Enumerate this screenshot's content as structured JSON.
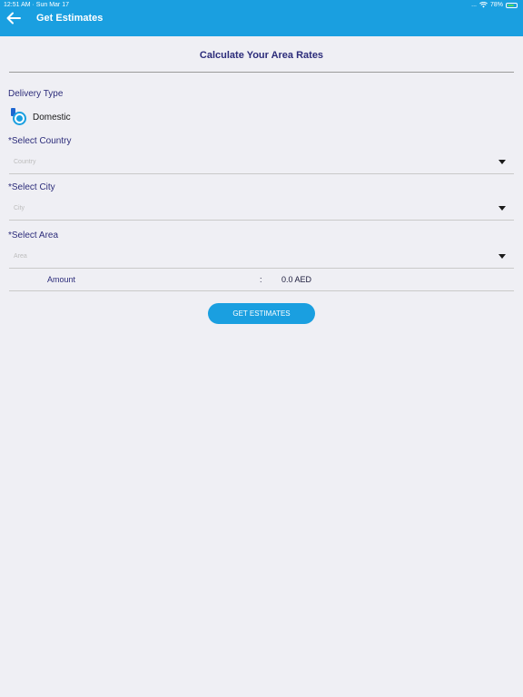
{
  "status_bar": {
    "time": "12:51 AM · Sun Mar 17",
    "dots": "...",
    "battery": "78%",
    "battery_level": 0.78
  },
  "header": {
    "title": "Get Estimates"
  },
  "page": {
    "title": "Calculate Your Area Rates"
  },
  "delivery_type": {
    "label": "Delivery Type",
    "option": "Domestic",
    "selected": true
  },
  "country": {
    "label": "*Select Country",
    "placeholder": "Country"
  },
  "city": {
    "label": "*Select City",
    "placeholder": "City"
  },
  "area": {
    "label": "*Select Area",
    "placeholder": "Area"
  },
  "amount": {
    "label": "Amount",
    "separator": ":",
    "value": "0.0 AED"
  },
  "actions": {
    "get_estimates": "GET ESTIMATES"
  },
  "colors": {
    "accent": "#1a9fe0",
    "heading": "#2c2c7a",
    "background": "#efeff4"
  }
}
